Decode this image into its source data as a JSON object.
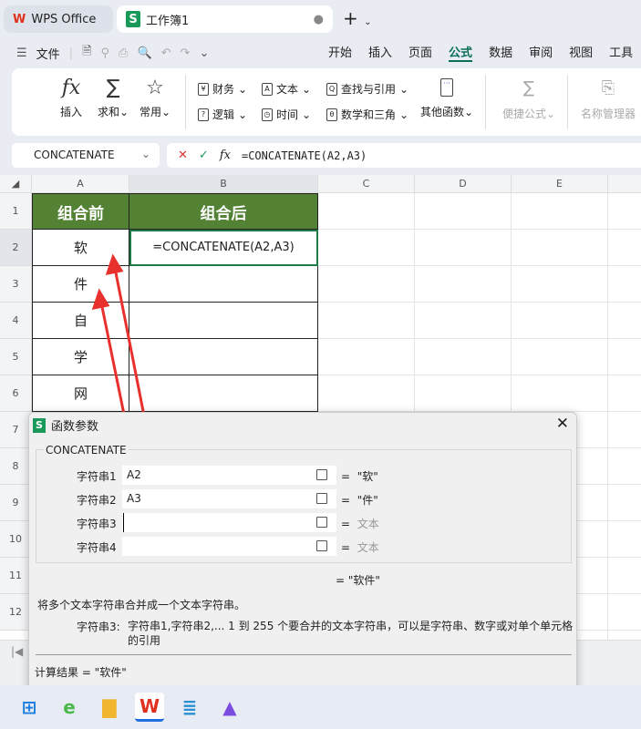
{
  "tabs": {
    "home": "WPS Office",
    "doc": "工作簿1"
  },
  "menu": {
    "file": "文件",
    "ribbon_tabs": [
      "开始",
      "插入",
      "页面",
      "公式",
      "数据",
      "审阅",
      "视图",
      "工具"
    ],
    "active": "公式"
  },
  "ribbon": {
    "insert": "插入",
    "sum": "求和",
    "common": "常用",
    "finance": "财务",
    "logic": "逻辑",
    "text": "文本",
    "time": "时间",
    "lookup": "查找与引用",
    "math": "数学和三角",
    "other": "其他函数",
    "quick": "便捷公式",
    "name_mgr": "名称管理器"
  },
  "formula_bar": {
    "name_box": "CONCATENATE",
    "formula": "=CONCATENATE(A2,A3)"
  },
  "columns": [
    "A",
    "B",
    "C",
    "D",
    "E"
  ],
  "rows": [
    "1",
    "2",
    "3",
    "4",
    "5",
    "6",
    "7",
    "8",
    "9",
    "10",
    "11",
    "12"
  ],
  "cells": {
    "A1": "组合前",
    "B1": "组合后",
    "A2": "软",
    "B2": "=CONCATENATE(A2,A3)",
    "A3": "件",
    "A4": "自",
    "A5": "学",
    "A6": "网"
  },
  "header_color": "#548235",
  "dialog": {
    "title": "函数参数",
    "func": "CONCATENATE",
    "args": [
      {
        "label": "字符串1",
        "value": "A2",
        "result": "\"软\""
      },
      {
        "label": "字符串2",
        "value": "A3",
        "result": "\"件\""
      },
      {
        "label": "字符串3",
        "value": "",
        "result": "文本"
      },
      {
        "label": "字符串4",
        "value": "",
        "result": "文本"
      }
    ],
    "eq": "=",
    "total": "= \"软件\"",
    "desc": "将多个文本字符串合并成一个文本字符串。",
    "arg_name": "字符串3:",
    "arg_desc": "字符串1,字符串2,... 1 到 255 个要合并的文本字符串，可以是字符串、数字或对单个单元格的引用",
    "calc": "计算结果 = \"软件\""
  }
}
